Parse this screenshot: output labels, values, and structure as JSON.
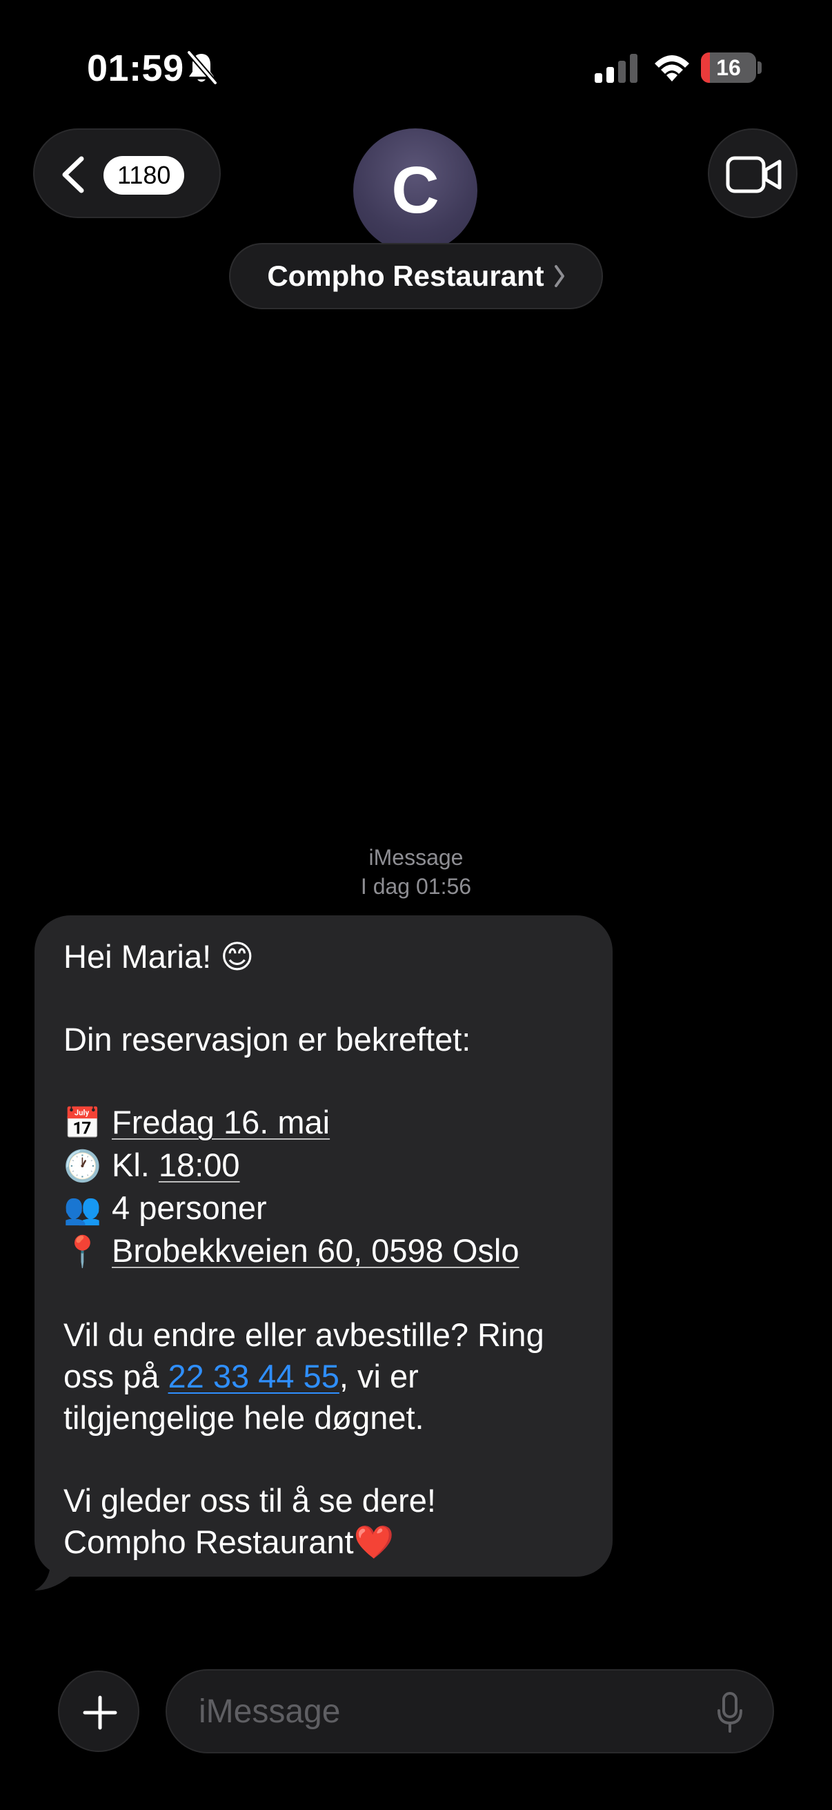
{
  "status_bar": {
    "time": "01:59",
    "battery": "16",
    "battery_level": 0.16,
    "battery_color": "#eb3b3b"
  },
  "header": {
    "back_count": "1180",
    "avatar_initial": "C",
    "contact_name": "Compho Restaurant",
    "icons": [
      "chevron-left-icon",
      "video-camera-icon",
      "chevron-right-icon"
    ]
  },
  "conversation": {
    "service": "iMessage",
    "timestamp": "I dag 01:56",
    "message": {
      "greeting": "Hei Maria! 😊",
      "confirmed": "Din reservasjon er bekreftet:",
      "date_emoji": "📅",
      "date": "Fredag 16. mai",
      "time_emoji": "🕐",
      "time_prefix": "Kl.",
      "time": "18:00",
      "people_emoji": "👥",
      "people": "4 personer",
      "location_emoji": "📍",
      "address": "Brobekkveien 60, 0598 Oslo",
      "change_text_1": "Vil du endre eller avbestille? Ring oss på",
      "phone": "22 33 44 55",
      "change_text_2": ", vi er tilgjengelige hele døgnet.",
      "closing": "Vi gleder oss til å se dere!",
      "signature": "Compho Restaurant",
      "signature_emoji": "❤️"
    }
  },
  "composer": {
    "placeholder": "iMessage",
    "link_color": "#2f8fff"
  }
}
